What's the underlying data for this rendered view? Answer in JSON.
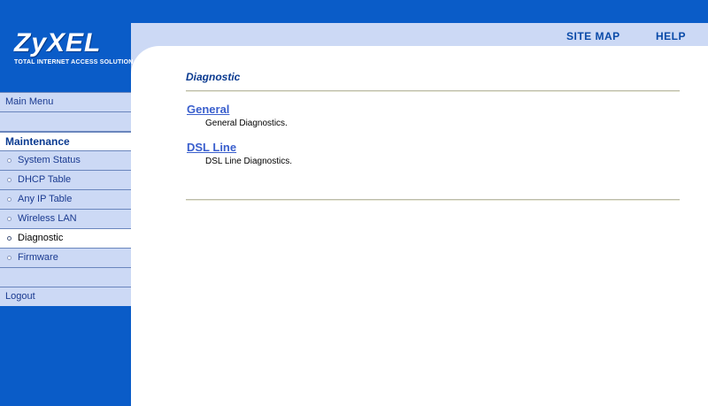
{
  "logo": {
    "name": "ZyXEL",
    "tagline": "TOTAL INTERNET ACCESS SOLUTION"
  },
  "header": {
    "site_map": "SITE MAP",
    "help": "HELP"
  },
  "sidebar": {
    "main_menu": "Main Menu",
    "section": "Maintenance",
    "items": [
      {
        "label": "System Status"
      },
      {
        "label": "DHCP Table"
      },
      {
        "label": "Any IP Table"
      },
      {
        "label": "Wireless LAN"
      },
      {
        "label": "Diagnostic",
        "active": true
      },
      {
        "label": "Firmware"
      }
    ],
    "logout": "Logout"
  },
  "main": {
    "title": "Diagnostic",
    "entries": [
      {
        "label": "General",
        "description": "General Diagnostics."
      },
      {
        "label": "DSL Line",
        "description": "DSL Line Diagnostics."
      }
    ]
  },
  "colors": {
    "brand_blue": "#0a5cc8",
    "light_band": "#ccd9f5",
    "link_blue": "#3a5fcd"
  }
}
